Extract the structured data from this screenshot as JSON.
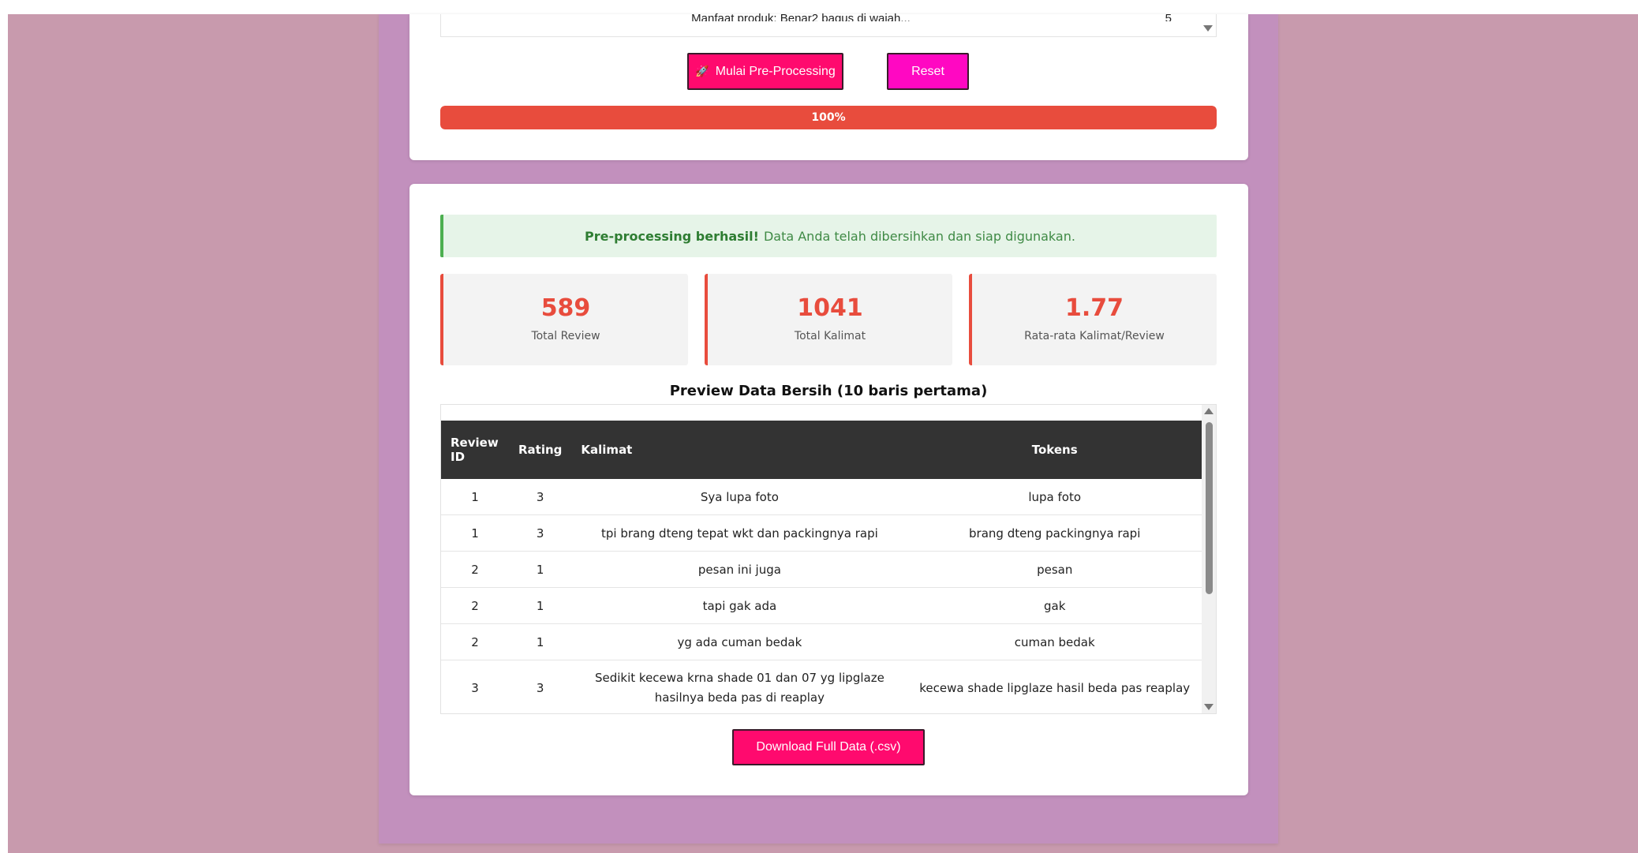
{
  "top_card": {
    "list_remnant_text": "Manfaat produk: Benar2 bagus di wajah...",
    "list_remnant_num": "5",
    "start_button": "Mulai Pre-Processing",
    "start_icon": "rocket-icon",
    "reset_button": "Reset",
    "progress_label": "100%",
    "progress_value": 100
  },
  "result": {
    "alert_strong": "Pre-processing berhasil!",
    "alert_text": "Data Anda telah dibersihkan dan siap digunakan.",
    "stats": [
      {
        "value": "589",
        "label": "Total Review"
      },
      {
        "value": "1041",
        "label": "Total Kalimat"
      },
      {
        "value": "1.77",
        "label": "Rata-rata Kalimat/Review"
      }
    ],
    "preview_title": "Preview Data Bersih (10 baris pertama)",
    "table": {
      "headers": [
        "Review ID",
        "Rating",
        "Kalimat",
        "Tokens"
      ],
      "rows": [
        [
          "1",
          "3",
          "Sya lupa foto",
          "lupa foto"
        ],
        [
          "1",
          "3",
          "tpi brang dteng tepat wkt dan packingnya rapi",
          "brang dteng packingnya rapi"
        ],
        [
          "2",
          "1",
          "pesan ini juga",
          "pesan"
        ],
        [
          "2",
          "1",
          "tapi gak ada",
          "gak"
        ],
        [
          "2",
          "1",
          "yg ada cuman bedak",
          "cuman bedak"
        ],
        [
          "3",
          "3",
          "Sedikit kecewa krna shade 01 dan 07 yg lipglaze hasilnya beda pas di reaplay",
          "kecewa shade lipglaze hasil beda pas reaplay"
        ]
      ]
    },
    "download_button": "Download Full Data (.csv)"
  },
  "colors": {
    "accent_pink": "#ff0a6e",
    "reset_magenta": "#ff08c2",
    "stat_red": "#e84c3d",
    "success_green": "#4caf50",
    "panel_purple": "#c290bd",
    "page_mauve": "#c89aad"
  }
}
